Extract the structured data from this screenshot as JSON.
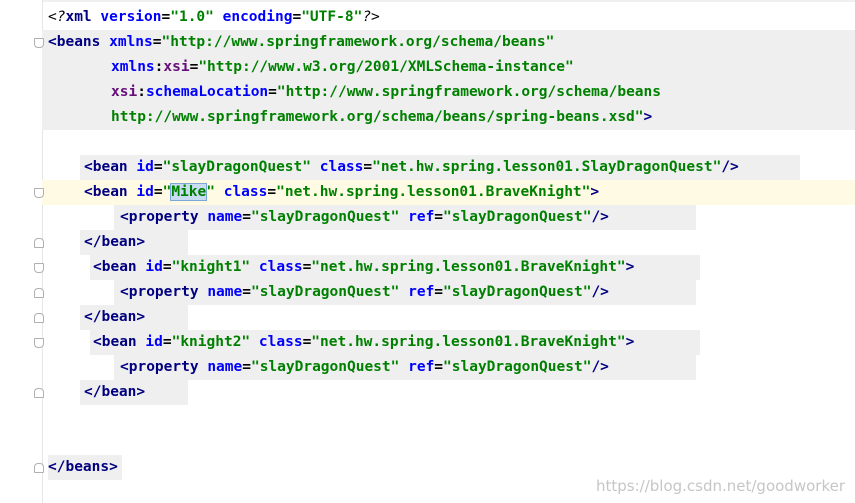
{
  "editor": {
    "lines": [
      {
        "parts": [
          {
            "t": "<?",
            "c": "proc"
          },
          {
            "t": "xml ",
            "c": "tag"
          },
          {
            "t": "version",
            "c": "attr"
          },
          {
            "t": "=",
            "c": "plain"
          },
          {
            "t": "\"1.0\"",
            "c": "str"
          },
          {
            "t": " encoding",
            "c": "attr"
          },
          {
            "t": "=",
            "c": "plain"
          },
          {
            "t": "\"UTF-8\"",
            "c": "str"
          },
          {
            "t": "?>",
            "c": "proc"
          }
        ]
      },
      {
        "parts": [
          {
            "t": "<beans ",
            "c": "tag"
          },
          {
            "t": "xmlns",
            "c": "attr"
          },
          {
            "t": "=",
            "c": "plain"
          },
          {
            "t": "\"http://www.springframework.org/schema/beans\"",
            "c": "str"
          }
        ]
      },
      {
        "parts": [
          {
            "t": "xmlns",
            "c": "attr"
          },
          {
            "t": ":",
            "c": "plain"
          },
          {
            "t": "xsi",
            "c": "ns"
          },
          {
            "t": "=",
            "c": "plain"
          },
          {
            "t": "\"http://www.w3.org/2001/XMLSchema-instance\"",
            "c": "str"
          }
        ]
      },
      {
        "parts": [
          {
            "t": "xsi",
            "c": "ns"
          },
          {
            "t": ":",
            "c": "plain"
          },
          {
            "t": "schemaLocation",
            "c": "attr"
          },
          {
            "t": "=",
            "c": "plain"
          },
          {
            "t": "\"http://www.springframework.org/schema/beans",
            "c": "str"
          }
        ]
      },
      {
        "parts": [
          {
            "t": "http://www.springframework.org/schema/beans/spring-beans.xsd\"",
            "c": "str"
          },
          {
            "t": ">",
            "c": "tag"
          }
        ]
      },
      {
        "parts": []
      },
      {
        "parts": [
          {
            "t": "<bean ",
            "c": "tag"
          },
          {
            "t": "id",
            "c": "attr"
          },
          {
            "t": "=",
            "c": "plain"
          },
          {
            "t": "\"slayDragonQuest\"",
            "c": "str"
          },
          {
            "t": " class",
            "c": "attr"
          },
          {
            "t": "=",
            "c": "plain"
          },
          {
            "t": "\"net.hw.spring.lesson01.SlayDragonQuest\"",
            "c": "str"
          },
          {
            "t": "/>",
            "c": "tag"
          }
        ]
      },
      {
        "parts": [
          {
            "t": "<bean ",
            "c": "tag"
          },
          {
            "t": "id",
            "c": "attr"
          },
          {
            "t": "=",
            "c": "plain"
          },
          {
            "t": "\"",
            "c": "str"
          },
          {
            "t": "Mike",
            "c": "str",
            "sel": true
          },
          {
            "t": "\"",
            "c": "str"
          },
          {
            "t": " class",
            "c": "attr"
          },
          {
            "t": "=",
            "c": "plain"
          },
          {
            "t": "\"net.hw.spring.lesson01.BraveKnight\"",
            "c": "str"
          },
          {
            "t": ">",
            "c": "tag"
          }
        ]
      },
      {
        "parts": [
          {
            "t": "<property ",
            "c": "tag"
          },
          {
            "t": "name",
            "c": "attr"
          },
          {
            "t": "=",
            "c": "plain"
          },
          {
            "t": "\"slayDragonQuest\"",
            "c": "str"
          },
          {
            "t": " ref",
            "c": "attr"
          },
          {
            "t": "=",
            "c": "plain"
          },
          {
            "t": "\"slayDragonQuest\"",
            "c": "str"
          },
          {
            "t": "/>",
            "c": "tag"
          }
        ]
      },
      {
        "parts": [
          {
            "t": "</bean>",
            "c": "tag"
          }
        ]
      },
      {
        "parts": [
          {
            "t": "<bean ",
            "c": "tag"
          },
          {
            "t": "id",
            "c": "attr"
          },
          {
            "t": "=",
            "c": "plain"
          },
          {
            "t": "\"knight1\"",
            "c": "str"
          },
          {
            "t": " class",
            "c": "attr"
          },
          {
            "t": "=",
            "c": "plain"
          },
          {
            "t": "\"net.hw.spring.lesson01.BraveKnight\"",
            "c": "str"
          },
          {
            "t": ">",
            "c": "tag"
          }
        ]
      },
      {
        "parts": [
          {
            "t": "<property ",
            "c": "tag"
          },
          {
            "t": "name",
            "c": "attr"
          },
          {
            "t": "=",
            "c": "plain"
          },
          {
            "t": "\"slayDragonQuest\"",
            "c": "str"
          },
          {
            "t": " ref",
            "c": "attr"
          },
          {
            "t": "=",
            "c": "plain"
          },
          {
            "t": "\"slayDragonQuest\"",
            "c": "str"
          },
          {
            "t": "/>",
            "c": "tag"
          }
        ]
      },
      {
        "parts": [
          {
            "t": "</bean>",
            "c": "tag"
          }
        ]
      },
      {
        "parts": [
          {
            "t": "<bean ",
            "c": "tag"
          },
          {
            "t": "id",
            "c": "attr"
          },
          {
            "t": "=",
            "c": "plain"
          },
          {
            "t": "\"knight2\"",
            "c": "str"
          },
          {
            "t": " class",
            "c": "attr"
          },
          {
            "t": "=",
            "c": "plain"
          },
          {
            "t": "\"net.hw.spring.lesson01.BraveKnight\"",
            "c": "str"
          },
          {
            "t": ">",
            "c": "tag"
          }
        ]
      },
      {
        "parts": [
          {
            "t": "<property ",
            "c": "tag"
          },
          {
            "t": "name",
            "c": "attr"
          },
          {
            "t": "=",
            "c": "plain"
          },
          {
            "t": "\"slayDragonQuest\"",
            "c": "str"
          },
          {
            "t": " ref",
            "c": "attr"
          },
          {
            "t": "=",
            "c": "plain"
          },
          {
            "t": "\"slayDragonQuest\"",
            "c": "str"
          },
          {
            "t": "/>",
            "c": "tag"
          }
        ]
      },
      {
        "parts": [
          {
            "t": "</bean>",
            "c": "tag"
          }
        ]
      },
      {
        "parts": []
      },
      {
        "parts": []
      },
      {
        "parts": [
          {
            "t": "</beans>",
            "c": "tag"
          }
        ]
      }
    ]
  },
  "watermark": "https://blog.csdn.net/goodworker",
  "colors": {
    "tag": "#000080",
    "attribute": "#0000ff",
    "namespace": "#660e7a",
    "string": "#008000",
    "caret_row": "#fffae3",
    "selection": "#c8dcf2"
  }
}
